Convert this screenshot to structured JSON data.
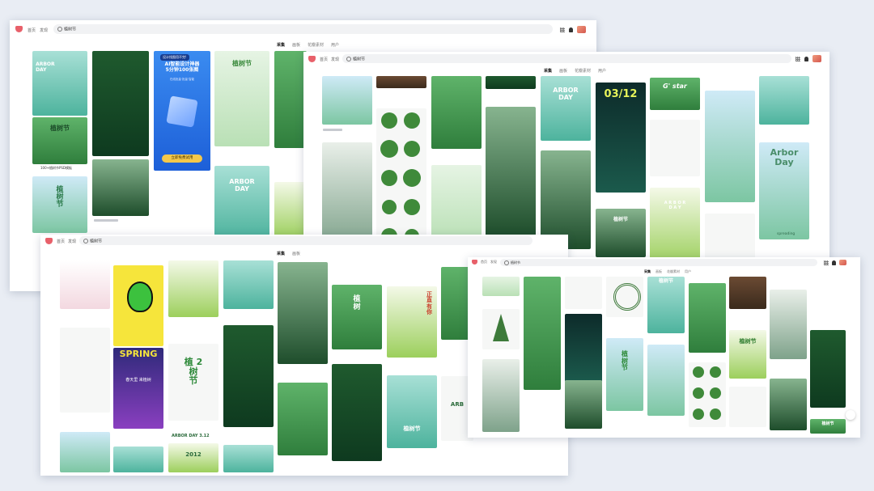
{
  "windows": [
    {
      "id": "w1",
      "nav": [
        "首页",
        "发现"
      ],
      "search": "植树节",
      "tabs": [
        "采集",
        "画板",
        "花瓣素材",
        "用户"
      ]
    },
    {
      "id": "w2",
      "nav": [
        "首页",
        "发现"
      ],
      "search": "植树节",
      "tabs": [
        "采集",
        "画板",
        "花瓣素材",
        "用户"
      ]
    },
    {
      "id": "w3",
      "nav": [
        "首页",
        "发现"
      ],
      "search": "植树节",
      "tabs": [
        "采集",
        "画板"
      ]
    },
    {
      "id": "w4",
      "nav": [
        "首页",
        "发现"
      ],
      "search": "植树节",
      "tabs": [
        "采集",
        "画板",
        "花瓣素材",
        "用户"
      ]
    }
  ],
  "w1_cards": {
    "arbor_day": "ARBOR\nDAY",
    "zhishujie": "植树节",
    "psd_label": "100+植树节PSD模板",
    "ai_title": "AI智能设计神器\n5分钟100张图",
    "ai_badge": "设计找图用不完!",
    "ai_sub": "在线批量·批量·智能",
    "ai_btn": "立即免费试用",
    "zhishujie2": "植\n树\n节",
    "arbor_day2": "ARBOR\nDAY",
    "zhishujie3": "植树节"
  },
  "w2_cards": {
    "date": "03/12",
    "gstar": "G' star",
    "arbor_day": "ARBOR\nDAY",
    "arbor_day_script": "Arbor\nDay",
    "spread": "spreading",
    "zhishujie": "植树节",
    "arbor_day_light": "A R B O R\nD A Y"
  },
  "w3_cards": {
    "spring": "SPRING",
    "spring_sub": "春天里 来植树",
    "plant": "植 2\n树\n节",
    "arbor_312": "ARBOR DAY 3.12",
    "year_2012": "2012",
    "zhishu": "植\n树",
    "zhishujie": "植树节",
    "zhengzhi": "正\n直\n有\n你",
    "pick": "312",
    "huji": "植树节",
    "arbor": "ARB"
  },
  "w4_cards": {
    "zhishujie": "植树节",
    "zhishujie2": "植\n树\n节",
    "shu": "树",
    "green_title": "植树节",
    "bottom": "植树节"
  },
  "colors": {
    "logo": "#e8606a",
    "background": "#e9edf4"
  }
}
